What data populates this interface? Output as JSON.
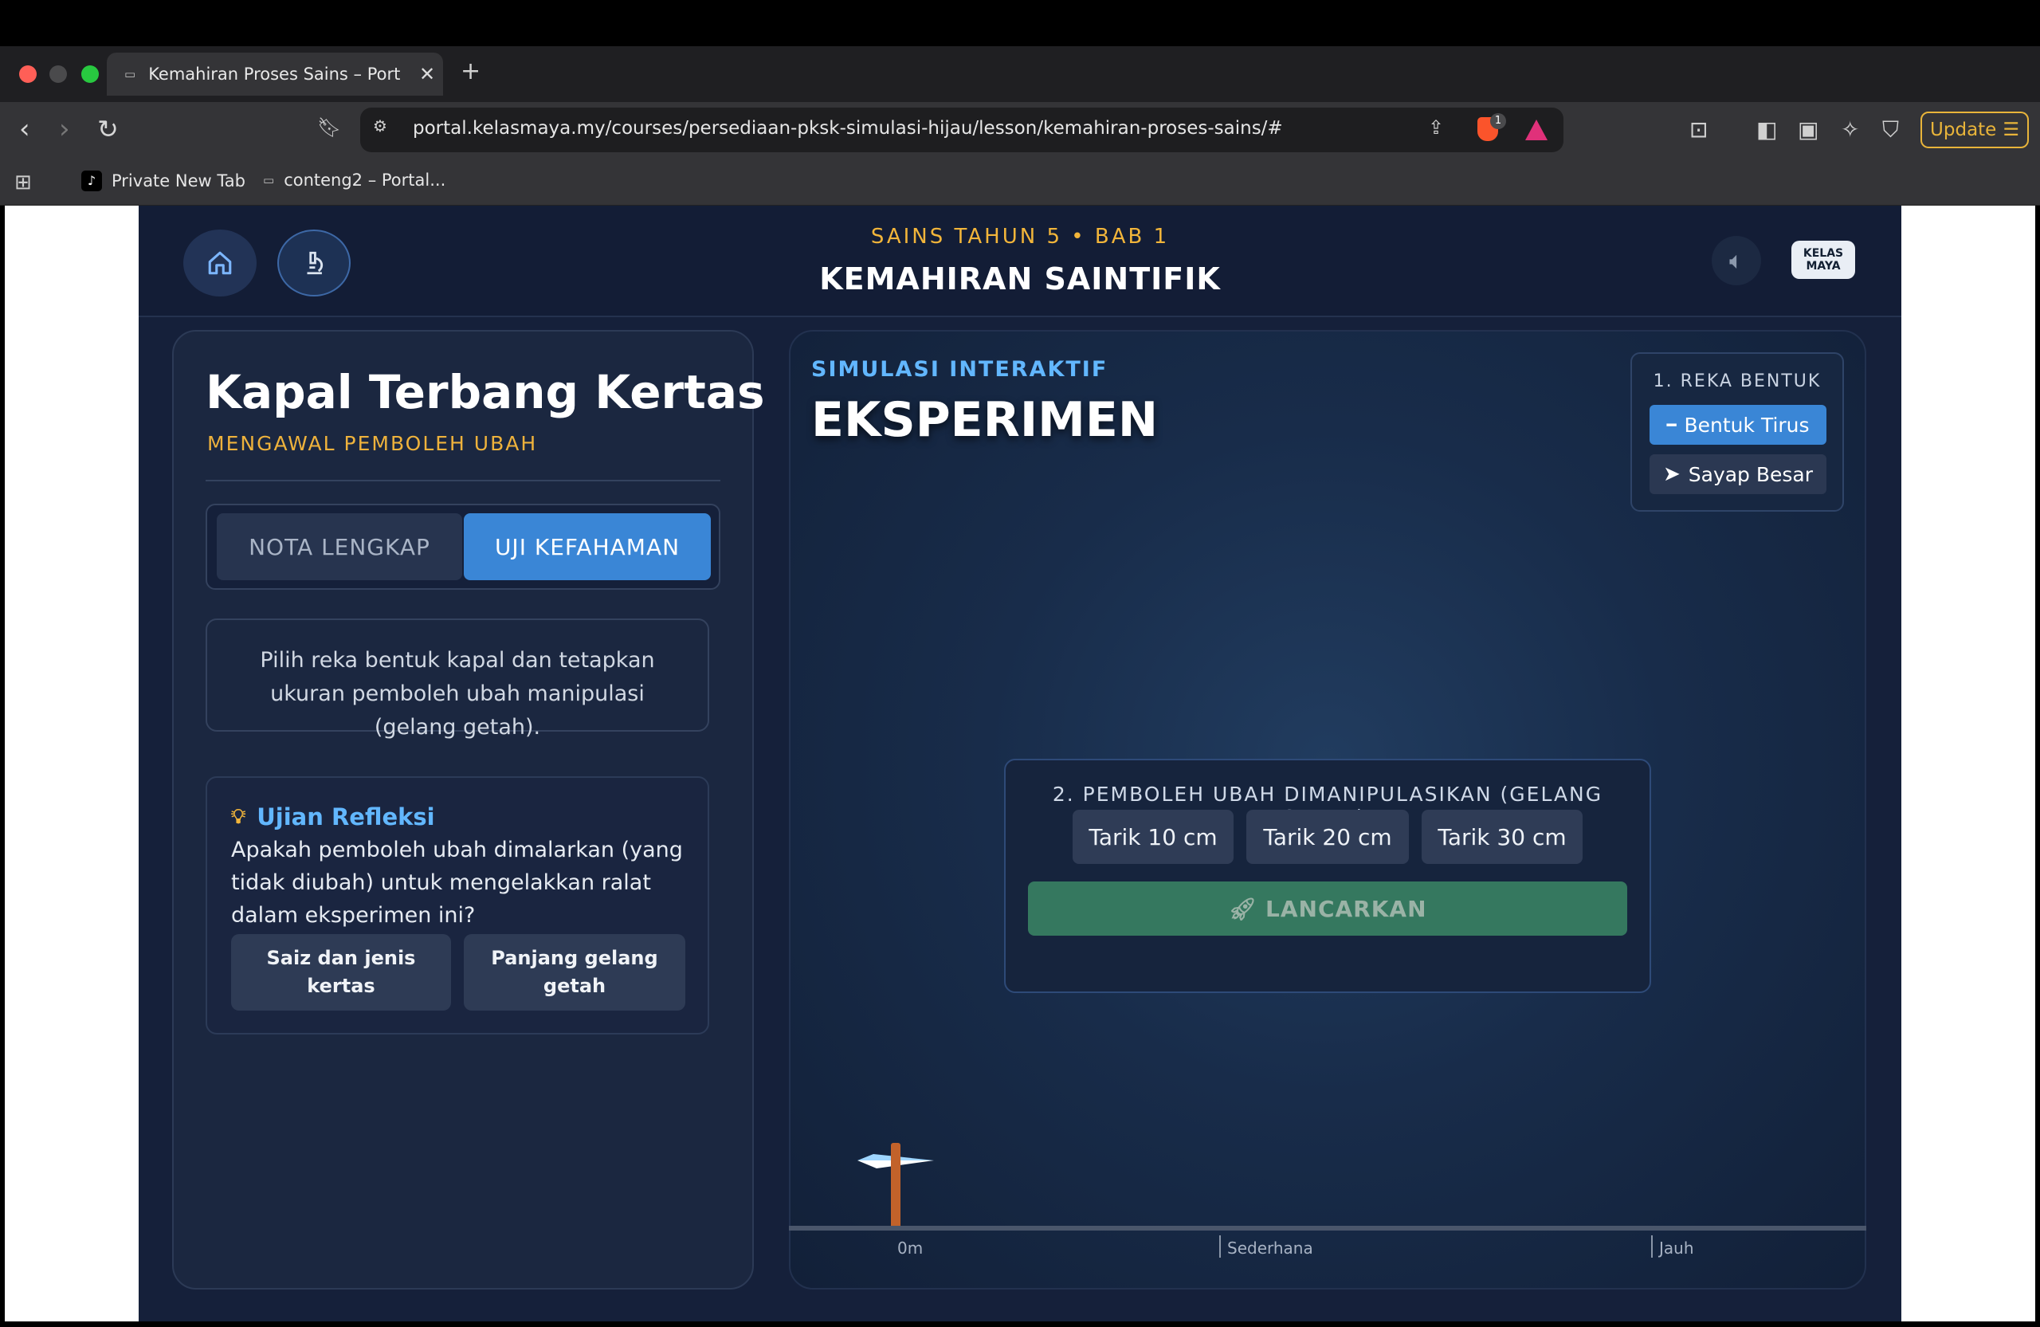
{
  "browser": {
    "tab_title": "Kemahiran Proses Sains – Port",
    "tab_close": "✕",
    "new_tab": "+",
    "url": "portal.kelasmaya.my/courses/persediaan-pksk-simulasi-hijau/lesson/kemahiran-proses-sains/#",
    "update_label": "Update",
    "brave_badge": "1",
    "bookmarks": [
      {
        "label": "Private New Tab",
        "icon": "tiktok-icon"
      },
      {
        "label": "conteng2 – Portal...",
        "icon": "page-icon"
      }
    ]
  },
  "header": {
    "subtitle": "SAINS TAHUN 5 • BAB 1",
    "title": "KEMAHIRAN SAINTIFIK",
    "logo_text": "KELAS MAYA"
  },
  "left_panel": {
    "title": "Kapal Terbang Kertas",
    "subtitle": "MENGAWAL PEMBOLEH UBAH",
    "tabs": [
      "NOTA LENGKAP",
      "UJI KEFAHAMAN"
    ],
    "active_tab": "UJI KEFAHAMAN",
    "instruction": "Pilih reka bentuk kapal dan tetapkan ukuran pemboleh ubah manipulasi (gelang getah).",
    "reflection": {
      "title": "Ujian Refleksi",
      "question": "Apakah pemboleh ubah dimalarkan (yang tidak diubah) untuk mengelakkan ralat dalam eksperimen ini?",
      "answers": [
        "Saiz dan jenis kertas",
        "Panjang gelang getah"
      ]
    }
  },
  "simulation": {
    "subtitle": "SIMULASI INTERAKTIF",
    "title": "EKSPERIMEN",
    "design": {
      "title": "1. REKA BENTUK",
      "options": [
        "Bentuk Tirus",
        "Sayap Besar"
      ],
      "selected": "Bentuk Tirus"
    },
    "manipulated": {
      "label": "2. PEMBOLEH UBAH DIMANIPULASIKAN (GELANG GETAH):",
      "options": [
        "Tarik 10 cm",
        "Tarik 20 cm",
        "Tarik 30 cm"
      ]
    },
    "launch_label": "LANCARKAN",
    "distance_labels": [
      "0m",
      "Sederhana",
      "Jauh"
    ]
  },
  "colors": {
    "accent_blue": "#3a86d6",
    "accent_gold": "#f2b53a",
    "launch_green": "#35785f",
    "page_bg": "#15203a"
  }
}
